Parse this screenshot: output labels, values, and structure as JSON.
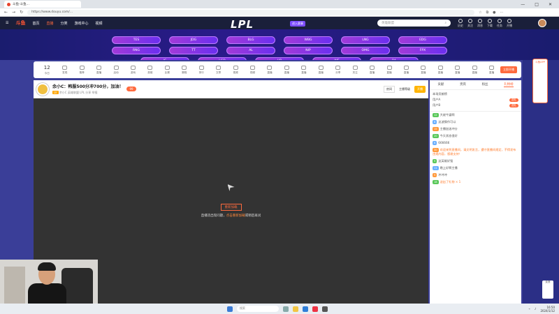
{
  "browser": {
    "tab_title": "斗鱼-斗鱼...",
    "url": "https://www.douyu.com/...",
    "window_buttons": [
      "—",
      "□",
      "✕"
    ]
  },
  "header": {
    "logo": "斗鱼",
    "nav": [
      "首页",
      "直播",
      "分类",
      "游戏中心",
      "视频"
    ],
    "event_logo": "LPL",
    "event_badge": "进入赛事",
    "search_placeholder": "英雄联盟",
    "icons": [
      {
        "name": "history",
        "label": "历史"
      },
      {
        "name": "follow",
        "label": "关注"
      },
      {
        "name": "message",
        "label": "消息"
      },
      {
        "name": "download",
        "label": "下载"
      },
      {
        "name": "task",
        "label": "任务"
      },
      {
        "name": "broadcast",
        "label": "开播"
      }
    ]
  },
  "banner": {
    "teams": [
      "TES",
      "JDG",
      "BLG",
      "WBG",
      "LNG",
      "EDG",
      "RNG",
      "TT",
      "AL",
      "NIP",
      "OMG",
      "FPX",
      "IG",
      "LGD",
      "UP",
      "WE",
      "RA"
    ]
  },
  "categories": {
    "date_num": "12",
    "date_label": "今日",
    "items": [
      "发现",
      "推荐",
      "直播",
      "活动",
      "游戏",
      "英雄",
      "比赛",
      "赛程",
      "排行",
      "文章",
      "视频",
      "视频",
      "直播",
      "直播",
      "直播",
      "直播",
      "分享",
      "关注",
      "直播",
      "直播",
      "直播",
      "直播",
      "直播",
      "直播",
      "直播",
      "直播"
    ],
    "button": "立即开播"
  },
  "stream": {
    "title": "余小C：韩服500分冲700分，加油！",
    "level_badge": "LV",
    "follow_count": "99",
    "meta": "余小C  英雄联盟  LPL  分享  举报",
    "right_box": "房间",
    "right_label": "主播等级",
    "right_yellow": "开播",
    "video_button": "重新加载",
    "video_msg_pre": "直播流出现问题，",
    "video_msg_link": "点击重新加载",
    "video_msg_post": "或稍后再试"
  },
  "chat": {
    "tabs": [
      "贡献",
      "贵宾",
      "粉丝",
      "礼物榜"
    ],
    "rank_title": "本场贡献榜",
    "rank_rows": [
      {
        "name": "用户A",
        "btn": "送礼"
      },
      {
        "name": "用户B",
        "btn": "送礼"
      }
    ],
    "messages": [
      {
        "level": "12",
        "text": "大佬牛逼啊",
        "cls": ""
      },
      {
        "level": "8",
        "text": "这波操作可以",
        "cls": ""
      },
      {
        "level": "15",
        "text": "主播加油冲分",
        "cls": ""
      },
      {
        "level": "20",
        "text": "今天状态很好",
        "cls": ""
      },
      {
        "level": "6",
        "text": "666666",
        "cls": ""
      },
      {
        "level": "30",
        "text": "欢迎来到直播间，请文明发言，遵守直播间规定，不得发布违规内容，感谢支持！",
        "cls": "orange"
      },
      {
        "level": "9",
        "text": "这英雄好强",
        "cls": ""
      },
      {
        "level": "11",
        "text": "晚上好啊主播",
        "cls": ""
      },
      {
        "level": "5",
        "text": "冲冲冲",
        "cls": ""
      },
      {
        "level": "18",
        "text": "送出了礼物 × 1",
        "cls": "orange"
      }
    ]
  },
  "side": {
    "app_label": "斗鱼APP",
    "float_label": "反馈"
  },
  "taskbar": {
    "search": "搜索",
    "time": "16:50",
    "date": "2024/1/12"
  }
}
